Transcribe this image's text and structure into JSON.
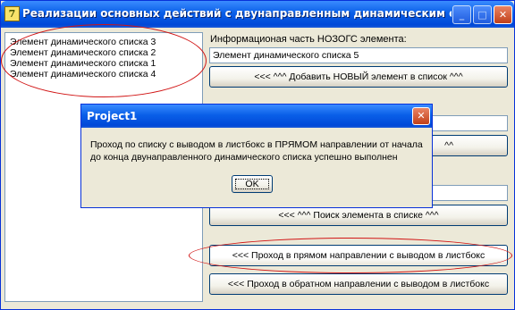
{
  "window": {
    "title": "Реализации основных действий с двунаправленным динамическим списком",
    "app_icon_glyph": "7",
    "minimize_glyph": "_",
    "maximize_glyph": "□",
    "close_glyph": "✕"
  },
  "listbox": {
    "items": [
      "Элемент динамического списка 3",
      "Элемент динамического списка 2",
      "Элемент динамического списка 1",
      "Элемент динамического списка 4"
    ]
  },
  "panel": {
    "info_label": "Информационая часть НОЗОГС элемента:",
    "info_value": "Элемент динамического списка 5",
    "add_button": "<<< ^^^ Добавить НОВЫЙ элемент в список ^^^",
    "partial_button_tail": "^^",
    "search_button": "<<< ^^^ Поиск элемента в списке ^^^",
    "forward_button": "<<< Проход в прямом направлении с выводом в листбокс",
    "backward_button": "<<< Проход в обратном направлении с выводом в листбокс"
  },
  "dialog": {
    "title": "Project1",
    "close_glyph": "✕",
    "message_line1": "Проход по списку с выводом в листбокс в ПРЯМОМ направлении от начала",
    "message_line2": "до конца двунаправленного динамического списка успешно выполнен",
    "ok_label": "OK"
  },
  "colors": {
    "titlebar_blue": "#0a5fe8",
    "annotation_red": "#d11414",
    "window_face": "#ece9d8"
  }
}
